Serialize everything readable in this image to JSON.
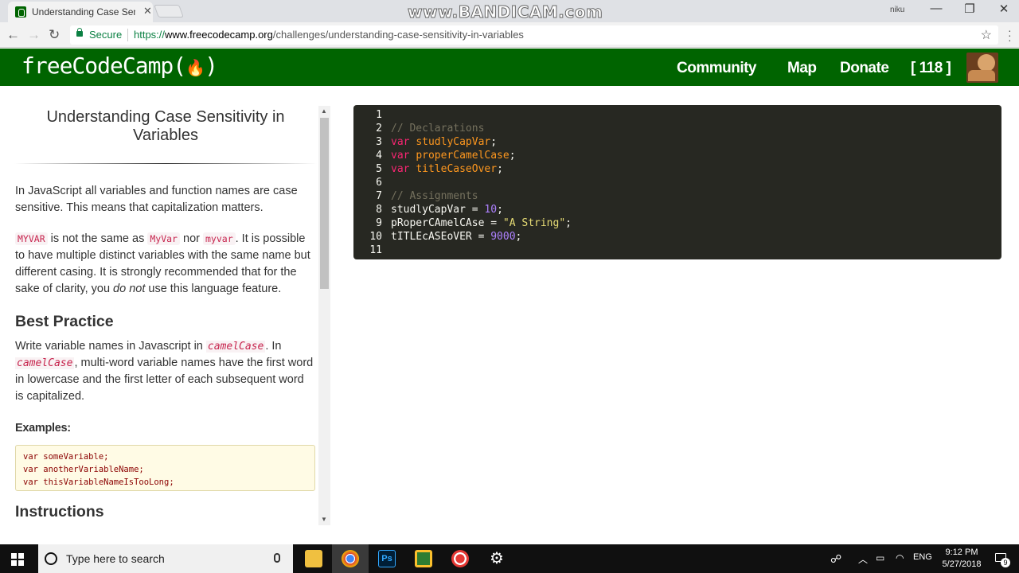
{
  "browser": {
    "tab_title": "Understanding Case Sensi",
    "tab_close": "✕",
    "watermark": "www.BANDICAM.com",
    "user_label": "niku",
    "minimize": "—",
    "maximize": "❐",
    "close": "✕",
    "secure_label": "Secure",
    "url_scheme": "https://",
    "url_host": "www.freecodecamp.org",
    "url_path": "/challenges/understanding-case-sensitivity-in-variables",
    "back": "←",
    "forward": "→",
    "reload": "↻",
    "star": "☆"
  },
  "nav": {
    "logo": "freeCodeCamp(",
    "logo_flame": "🔥",
    "logo_end": ")",
    "community": "Community",
    "map": "Map",
    "donate": "Donate",
    "points": "[ 118 ]"
  },
  "lesson": {
    "title": "Understanding Case Sensitivity in Variables",
    "p1": "In JavaScript all variables and function names are case sensitive. This means that capitalization matters.",
    "p2_code1": "MYVAR",
    "p2_t1": " is not the same as ",
    "p2_code2": "MyVar",
    "p2_t2": " nor ",
    "p2_code3": "myvar",
    "p2_t3": ". It is possible to have multiple distinct variables with the same name but different casing. It is strongly recommended that for the sake of clarity, you ",
    "p2_em": "do not",
    "p2_t4": " use this language feature.",
    "best_practice": "Best Practice",
    "p3_t1": "Write variable names in Javascript in ",
    "p3_code1": "camelCase",
    "p3_t2": ". In ",
    "p3_code2": "camelCase",
    "p3_t3": ", multi-word variable names have the first word in lowercase and the first letter of each subsequent word is capitalized.",
    "examples_heading": "Examples:",
    "examples": [
      "var someVariable;",
      "var anotherVariableName;",
      "var thisVariableNameIsTooLong;"
    ],
    "instructions": "Instructions"
  },
  "editor": {
    "lines": [
      {
        "n": "1",
        "text": ""
      },
      {
        "n": "2",
        "text": "// Declarations"
      },
      {
        "n": "3",
        "text": "var studlyCapVar;"
      },
      {
        "n": "4",
        "text": "var properCamelCase;"
      },
      {
        "n": "5",
        "text": "var titleCaseOver;"
      },
      {
        "n": "6",
        "text": ""
      },
      {
        "n": "7",
        "text": "// Assignments"
      },
      {
        "n": "8",
        "text": "studlyCapVar = 10;"
      },
      {
        "n": "9",
        "text": "pRoperCAmelCAse = \"A String\";"
      },
      {
        "n": "10",
        "text": "tITLEcASEoVER = 9000;"
      },
      {
        "n": "11",
        "text": ""
      }
    ],
    "l2_comment": "// Declarations",
    "l3_kw": "var",
    "l3_name": "studlyCapVar",
    "l3_end": ";",
    "l4_kw": "var",
    "l4_name": "properCamelCase",
    "l4_end": ";",
    "l5_kw": "var",
    "l5_name": "titleCaseOver",
    "l5_end": ";",
    "l7_comment": "// Assignments",
    "l8_name": "studlyCapVar",
    "l8_op": " = ",
    "l8_num": "10",
    "l8_end": ";",
    "l9_name": "pRoperCAmelCAse",
    "l9_op": " = ",
    "l9_str": "\"A String\"",
    "l9_end": ";",
    "l10_name": "tITLEcASEoVER",
    "l10_op": " = ",
    "l10_num": "9000",
    "l10_end": ";"
  },
  "taskbar": {
    "search_placeholder": "Type here to search",
    "lang": "ENG",
    "time": "9:12 PM",
    "date": "5/27/2018",
    "notif_count": "9",
    "ps_label": "Ps"
  }
}
